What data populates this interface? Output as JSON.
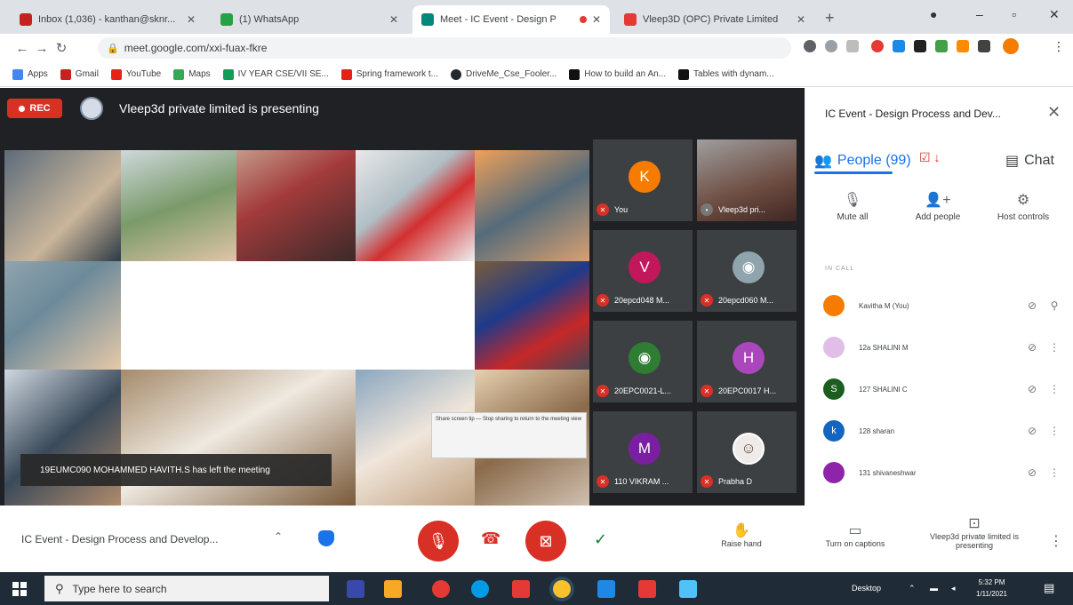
{
  "browser": {
    "tabs": [
      {
        "title": "Inbox (1,036) - kanthan@sknr... ",
        "color": "#c5221f",
        "active": false
      },
      {
        "title": "(1) WhatsApp",
        "color": "#25a244",
        "active": false
      },
      {
        "title": "Meet - IC Event - Design P",
        "color": "#00897b",
        "active": true,
        "recording": true
      },
      {
        "title": "Vleep3D (OPC) Private Limited",
        "color": "#e53935",
        "active": false
      }
    ],
    "url": "meet.google.com/xxi-fuax-fkre",
    "bookmarks": [
      "Apps",
      "Gmail",
      "YouTube",
      "Maps",
      "IV YEAR CSE/VII SE...",
      "Spring framework t...",
      "DriveMe_Cse_Fooler...",
      "How to build an An...",
      "Tables with dynam..."
    ]
  },
  "meet": {
    "rec_label": "REC",
    "presenting_banner": "Vleep3d private limited is presenting",
    "left_notification": "19EUMC090 MOHAMMED HAVITH.S has left the meeting",
    "popup_text": "Share screen tip — Stop sharing to return to the meeting view",
    "participants": [
      {
        "initial": "K",
        "name": "You",
        "color": "#f57c00",
        "kind": "avatar"
      },
      {
        "initial": "",
        "name": "Vleep3d pri...",
        "color": "#8d6e63",
        "kind": "video"
      },
      {
        "initial": "V",
        "name": "20epcd048 M...",
        "color": "#c2185b",
        "kind": "avatar"
      },
      {
        "initial": "",
        "name": "20epcd060 M...",
        "color": "#90a4ae",
        "kind": "photo"
      },
      {
        "initial": "",
        "name": "20EPC0021-L...",
        "color": "#2e7d32",
        "kind": "photo"
      },
      {
        "initial": "H",
        "name": "20EPC0017 H...",
        "color": "#ab47bc",
        "kind": "avatar"
      },
      {
        "initial": "M",
        "name": "110 VIKRAM ...",
        "color": "#7b1fa2",
        "kind": "avatar"
      },
      {
        "initial": "",
        "name": "Prabha D",
        "color": "#efebe9",
        "kind": "face"
      }
    ]
  },
  "panel": {
    "title": "IC Event - Design Process and Dev...",
    "tab_people": "People (99)",
    "tab_chat": "Chat",
    "actions": [
      "Mute all",
      "Add people",
      "Host controls"
    ],
    "section_label": "IN CALL",
    "people": [
      {
        "initial": "",
        "name": "Kavitha M (You)",
        "color": "#f57c00"
      },
      {
        "initial": "",
        "name": "12a SHALINI M",
        "color": "#e1bee7"
      },
      {
        "initial": "S",
        "name": "127 SHALINI C",
        "color": "#1b5e20"
      },
      {
        "initial": "k",
        "name": "128 sharan",
        "color": "#1565c0"
      },
      {
        "initial": "",
        "name": "131 shivaneshwar",
        "color": "#8e24aa"
      }
    ]
  },
  "bottom": {
    "meeting_name": "IC Event - Design Process and Develop...",
    "raise_hand": "Raise hand",
    "captions": "Turn on captions",
    "presenting": "Vleep3d private limited is presenting"
  },
  "taskbar": {
    "search_placeholder": "Type here to search",
    "desktop": "Desktop",
    "time": "5:32 PM",
    "date": "1/11/2021"
  }
}
